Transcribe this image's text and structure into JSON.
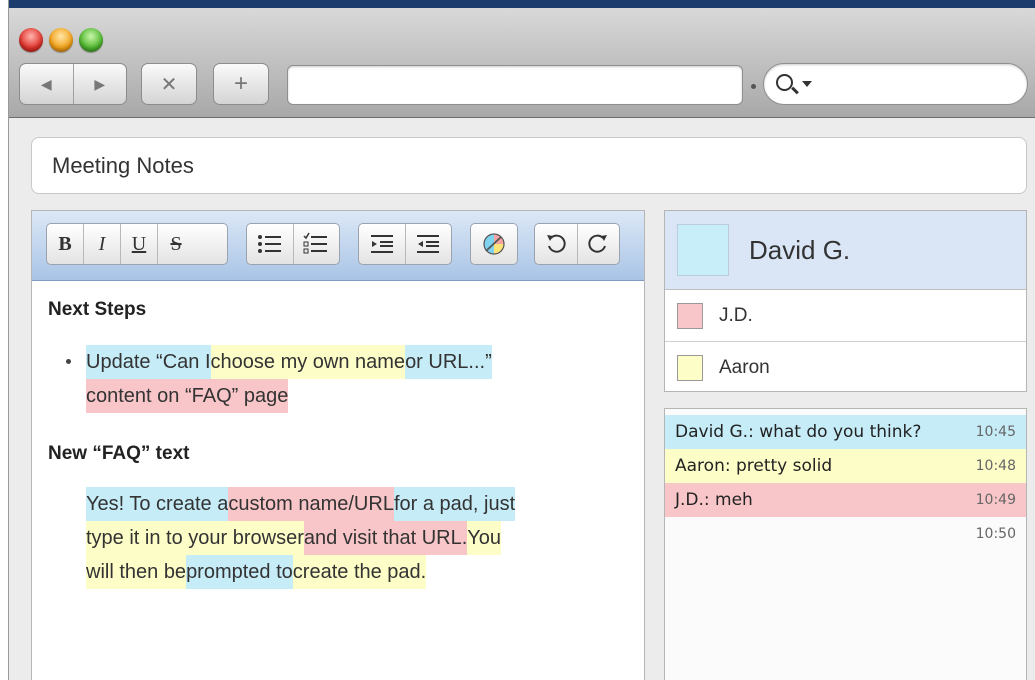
{
  "toolbar": {
    "back_glyph": "◀",
    "forward_glyph": "▶",
    "stop_glyph": "✕",
    "new_tab_glyph": "+",
    "url_value": "",
    "search_value": ""
  },
  "pad": {
    "title": "Meeting Notes"
  },
  "editor_toolbar": {
    "bold": "B",
    "italic": "I",
    "underline": "U",
    "strike": "S"
  },
  "document": {
    "heading1": "Next Steps",
    "bullet_line1": [
      {
        "text": "Update “Can I ",
        "author": "b"
      },
      {
        "text": "choose my own name ",
        "author": "y"
      },
      {
        "text": "or URL...”",
        "author": "b"
      }
    ],
    "bullet_line2": [
      {
        "text": "content on “FAQ” page",
        "author": "r"
      }
    ],
    "heading2": "New “FAQ” text",
    "para_line1": [
      {
        "text": "Yes! To create a ",
        "author": "b"
      },
      {
        "text": "custom name/URL ",
        "author": "r"
      },
      {
        "text": "for a pad, just",
        "author": "b"
      }
    ],
    "para_line2": [
      {
        "text": "type it in to your browser ",
        "author": "y"
      },
      {
        "text": "and visit that URL. ",
        "author": "r"
      },
      {
        "text": "You",
        "author": "y"
      }
    ],
    "para_line3": [
      {
        "text": "will then be ",
        "author": "y"
      },
      {
        "text": "prompted to ",
        "author": "b"
      },
      {
        "text": "create the pad.",
        "author": "y"
      }
    ]
  },
  "users": {
    "me": {
      "name": "David G.",
      "color": "#c8eef9"
    },
    "others": [
      {
        "name": "J.D.",
        "color": "#f8c6c8"
      },
      {
        "name": "Aaron",
        "color": "#fdfdc8"
      }
    ]
  },
  "chat": {
    "messages": [
      {
        "text": "David G.: what do you think?",
        "time": "10:45",
        "color": "#c6ecf8"
      },
      {
        "text": "Aaron: pretty solid",
        "time": "10:48",
        "color": "#fdfdc8"
      },
      {
        "text": "J.D.: meh",
        "time": "10:49",
        "color": "#f8c6c8"
      },
      {
        "text": "",
        "time": "10:50",
        "color": ""
      }
    ]
  },
  "colors": {
    "author_b": "#c6ecf8",
    "author_y": "#fdfdc8",
    "author_r": "#f8c6c8"
  }
}
